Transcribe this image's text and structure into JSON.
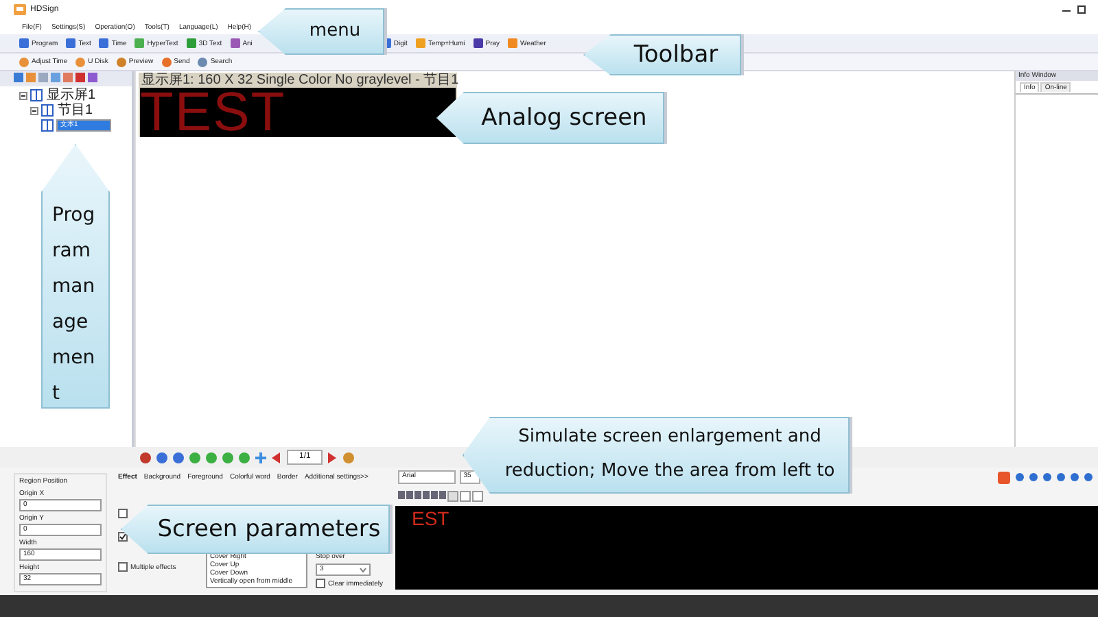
{
  "window": {
    "title": "HDSign"
  },
  "menu": [
    "File(F)",
    "Settings(S)",
    "Operation(O)",
    "Tools(T)",
    "Language(L)",
    "Help(H)"
  ],
  "toolbar": [
    "Program",
    "Text",
    "Time",
    "HyperText",
    "3D Text",
    "Ani",
    "Digit",
    "Temp+Humi",
    "Pray",
    "Weather"
  ],
  "toolbar2": [
    "Adjust Time",
    "U Disk",
    "Preview",
    "Send",
    "Search"
  ],
  "tree": [
    {
      "label": "显示屏1",
      "expanded": true,
      "selected": false,
      "children": [
        {
          "label": "节目1",
          "expanded": true,
          "selected": false,
          "children": [
            {
              "label": "文本1",
              "selected": true
            }
          ]
        }
      ]
    }
  ],
  "analog_screen": {
    "header": "显示屏1: 160 X 32  Single Color No graylevel - 节目1",
    "text": "TEST"
  },
  "info_window": {
    "title": "Info Window",
    "tabs": [
      {
        "label": "Info",
        "selected": true
      },
      {
        "label": "On-line",
        "selected": false
      }
    ]
  },
  "sim_toolbar": {
    "page": "1/1"
  },
  "region_position": {
    "title": "Region Position",
    "fields": [
      {
        "label": "Origin X",
        "value": "0"
      },
      {
        "label": "Origin Y",
        "value": "0"
      },
      {
        "label": "Width",
        "value": "160"
      },
      {
        "label": "Height",
        "value": "32"
      }
    ]
  },
  "effect_tabs": [
    {
      "label": "Effect",
      "selected": true
    },
    {
      "label": "Background",
      "selected": false
    },
    {
      "label": "Foreground",
      "selected": false
    },
    {
      "label": "Colorful word",
      "selected": false
    },
    {
      "label": "Border",
      "selected": false
    },
    {
      "label": "Additional settings>>",
      "selected": false
    }
  ],
  "effect_checks": [
    {
      "checked": false
    },
    {
      "checked": true
    }
  ],
  "multiple_effects": {
    "label": "Multiple effects",
    "checked": false
  },
  "effect_list": [
    "Cover Right",
    "Cover Up",
    "Cover Down",
    "Vertically open from middle"
  ],
  "stop_over": {
    "label": "Stop over",
    "value": "3"
  },
  "clear_immediately": {
    "label": "Clear immediately",
    "checked": false
  },
  "font": {
    "family": "Arial",
    "size": "35"
  },
  "preview_text": "EST",
  "callouts": [
    {
      "kind": "left",
      "lines": [
        "menu"
      ]
    },
    {
      "kind": "left",
      "lines": [
        "Toolbar"
      ]
    },
    {
      "kind": "left",
      "lines": [
        "Analog screen"
      ]
    },
    {
      "kind": "up",
      "lines": [
        "Program management"
      ]
    },
    {
      "kind": "left",
      "lines": [
        "Simulate screen enlargement and",
        "reduction; Move the area from left to"
      ]
    },
    {
      "kind": "left",
      "lines": [
        "Screen parameters"
      ]
    }
  ]
}
